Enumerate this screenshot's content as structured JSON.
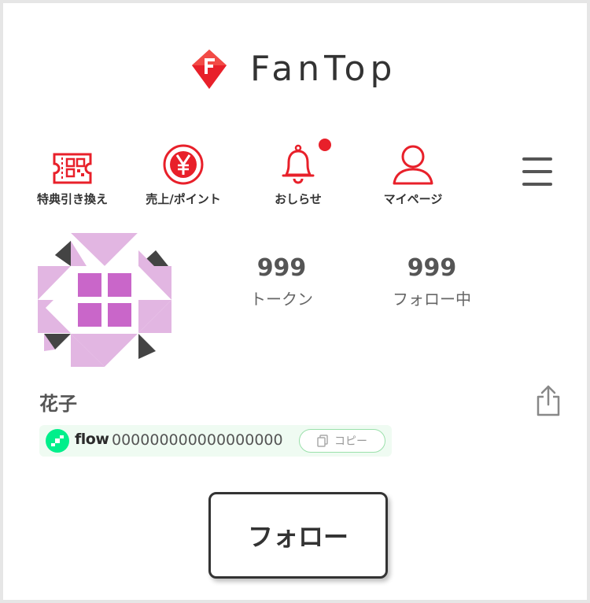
{
  "brand": {
    "name": "FanTop",
    "color": "#e8202a"
  },
  "nav": {
    "items": [
      {
        "label": "特典引き換え",
        "icon": "ticket-qr-icon"
      },
      {
        "label": "売上/ポイント",
        "icon": "yen-coin-icon"
      },
      {
        "label": "おしらせ",
        "icon": "bell-icon",
        "has_notification": true
      },
      {
        "label": "マイページ",
        "icon": "user-icon"
      }
    ],
    "menu_icon": "hamburger-menu-icon"
  },
  "profile": {
    "tokens": {
      "count": "999",
      "label": "トークン"
    },
    "following": {
      "count": "999",
      "label": "フォロー中"
    },
    "name": "花子",
    "share_icon": "share-icon",
    "wallet": {
      "chain": "flow",
      "address": "000000000000000000",
      "copy_label": "コピー"
    },
    "follow_label": "フォロー"
  },
  "colors": {
    "accent": "#e8202a",
    "flow_green": "#00ef8b",
    "avatar_pink": "#e2b6e2",
    "avatar_purple": "#c966c9"
  }
}
